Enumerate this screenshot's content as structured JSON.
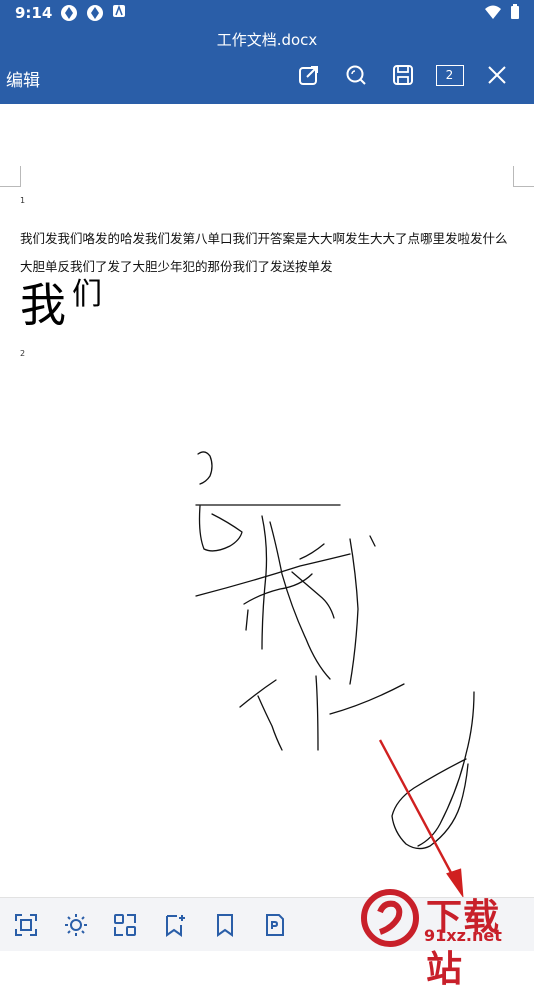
{
  "status_bar": {
    "time": "9:14"
  },
  "header": {
    "document_title": "工作文档.docx",
    "edit_label": "编辑",
    "page_count": "2",
    "icons": [
      "share-icon",
      "search-icon",
      "save-icon",
      "page-count-icon",
      "close-icon"
    ]
  },
  "document": {
    "page1_number": "1",
    "paragraph1": "我们发我们咯发的哈发我们发第八单口我们开答案是大大啊发生大大了点哪里发啦发什么",
    "paragraph2": "大胆单反我们了发了大胆少年犯的那份我们了发送按单发",
    "big_char_1": "我",
    "big_char_2": "们",
    "page2_number": "2"
  },
  "bottom_toolbar": {
    "icons": [
      "crop-icon",
      "brightness-icon",
      "scan-icon",
      "bookmark-add-icon",
      "bookmark-icon",
      "pdf-icon"
    ]
  },
  "watermark": {
    "text": "下载站",
    "url": "91xz.net"
  },
  "colors": {
    "header_bg": "#2a5ea8",
    "accent_red": "#c8202a"
  }
}
